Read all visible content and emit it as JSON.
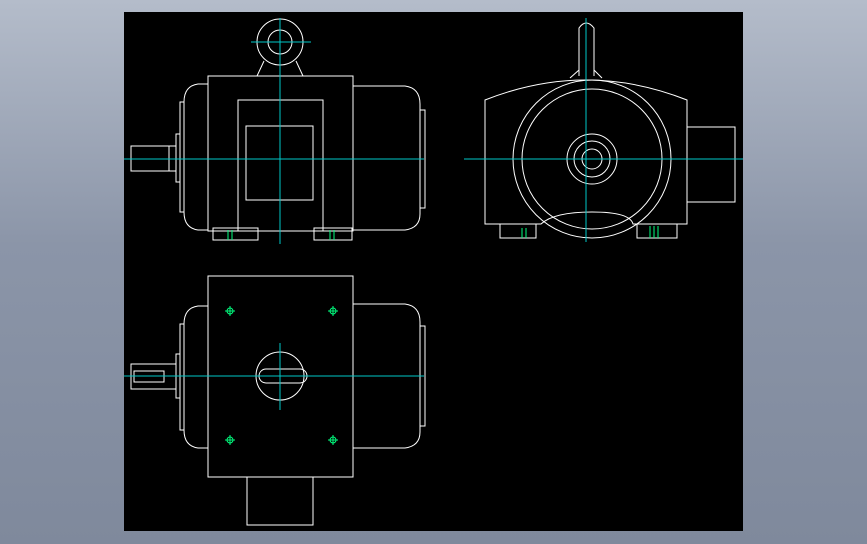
{
  "colors": {
    "viewport_background": "#000000",
    "outline": "#ffffff",
    "centerline": "#00c8c8",
    "bolt_holes": "#00ff7f"
  },
  "views": [
    "front-view",
    "side-view",
    "top-view"
  ]
}
